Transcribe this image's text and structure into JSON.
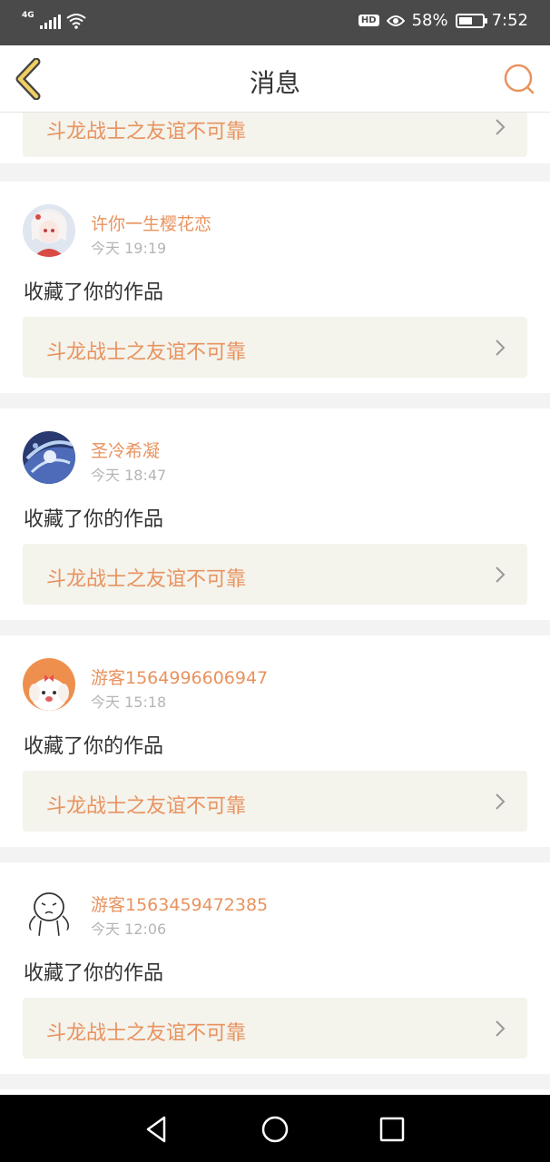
{
  "status_bar": {
    "network": "4G",
    "battery_percent": "58%",
    "battery_level": 0.58,
    "time": "7:52",
    "hd_label": "HD"
  },
  "header": {
    "title": "消息",
    "back_icon": "chevron-left-icon",
    "search_icon": "search-icon"
  },
  "colors": {
    "accent": "#e8935f",
    "work_bg": "#f4f3ec",
    "back_icon_fill": "#f0d060"
  },
  "partial_item": {
    "work_title": "斗龙战士之友谊不可靠"
  },
  "messages": [
    {
      "username": "许你一生樱花恋",
      "time": "今天 19:19",
      "action": "收藏了你的作品",
      "work_title": "斗龙战士之友谊不可靠",
      "avatar": "anime-girl-avatar"
    },
    {
      "username": "圣冷希凝",
      "time": "今天 18:47",
      "action": "收藏了你的作品",
      "work_title": "斗龙战士之友谊不可靠",
      "avatar": "anime-blue-avatar"
    },
    {
      "username": "游客1564996606947",
      "time": "今天 15:18",
      "action": "收藏了你的作品",
      "work_title": "斗龙战士之友谊不可靠",
      "avatar": "cartoon-dog-avatar"
    },
    {
      "username": "游客1563459472385",
      "time": "今天 12:06",
      "action": "收藏了你的作品",
      "work_title": "斗龙战士之友谊不可靠",
      "avatar": "doodle-avatar"
    }
  ],
  "nav": {
    "back": "triangle-back-icon",
    "home": "circle-home-icon",
    "recents": "square-recents-icon"
  }
}
